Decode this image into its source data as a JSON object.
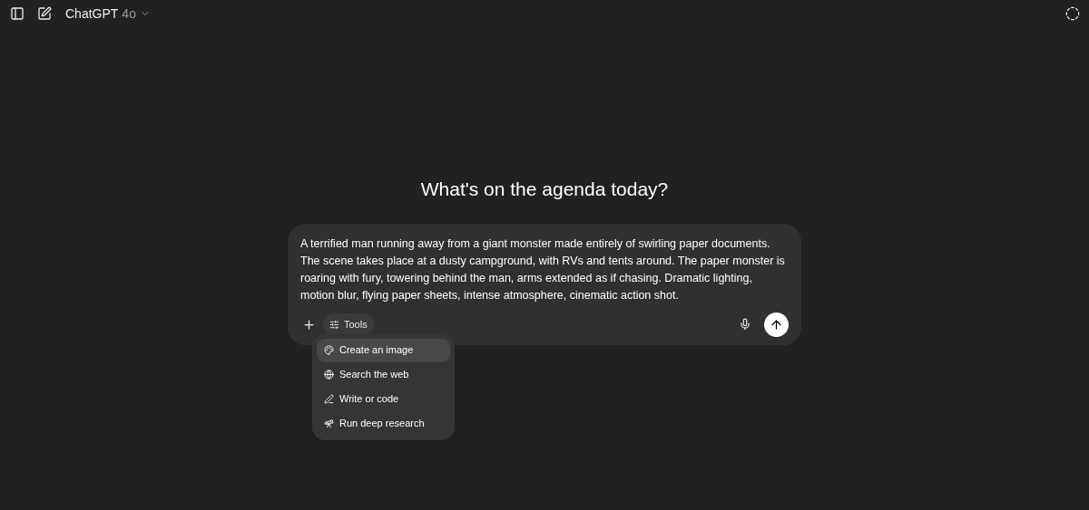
{
  "header": {
    "model_name": "ChatGPT",
    "model_version": "4o"
  },
  "heading": "What's on the agenda today?",
  "composer": {
    "value": "A terrified man running away from a giant monster made entirely of swirling paper documents. The scene takes place at a dusty campground, with RVs and tents around. The paper monster is roaring with fury, towering behind the man, arms extended as if chasing. Dramatic lighting, motion blur, flying paper sheets, intense atmosphere, cinematic action shot.",
    "tools_label": "Tools"
  },
  "tools_menu": [
    {
      "kind": "image",
      "label": "Create an image",
      "selected": true
    },
    {
      "kind": "web",
      "label": "Search the web",
      "selected": false
    },
    {
      "kind": "code",
      "label": "Write or code",
      "selected": false
    },
    {
      "kind": "research",
      "label": "Run deep research",
      "selected": false
    }
  ]
}
